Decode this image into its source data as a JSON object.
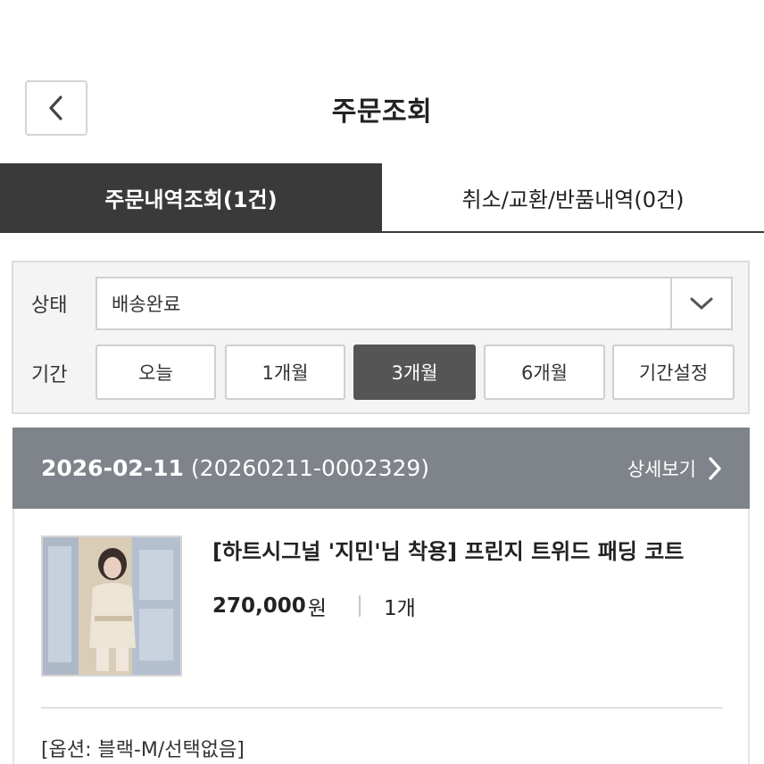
{
  "header": {
    "title": "주문조회",
    "back_icon": "chevron-left-icon"
  },
  "tabs": [
    {
      "label": "주문내역조회(1건)",
      "active": true
    },
    {
      "label": "취소/교환/반품내역(0건)",
      "active": false
    }
  ],
  "filters": {
    "status_label": "상태",
    "status_value": "배송완료",
    "dropdown_icon": "chevron-down-icon",
    "period_label": "기간",
    "periods": [
      "오늘",
      "1개월",
      "3개월",
      "6개월",
      "기간설정"
    ],
    "selected_period": "3개월"
  },
  "order": {
    "date": "2026-02-11",
    "number": "(20260211-0002329)",
    "detail_label": "상세보기",
    "detail_icon": "chevron-right-icon",
    "product_name": "[하트시그널 '지민'님 착용] 프린지 트위드 패딩 코트",
    "price": "270,000",
    "price_unit": "원",
    "quantity": "1개",
    "option": "[옵션: 블랙-M/선택없음]"
  },
  "colors": {
    "tab_active_bg": "#3a3a3a",
    "period_selected_bg": "#555555",
    "order_header_bg": "#7f838a"
  }
}
